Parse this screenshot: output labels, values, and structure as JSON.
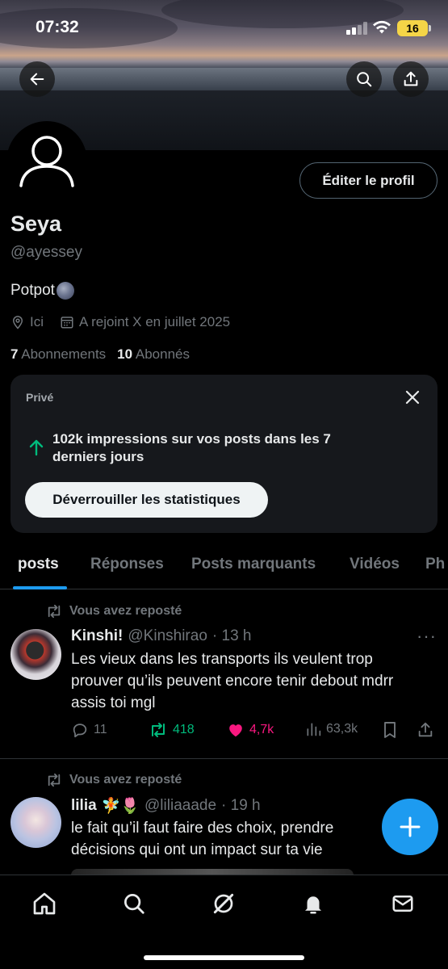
{
  "status_bar": {
    "time": "07:32",
    "battery": "16"
  },
  "profile": {
    "name": "Seya",
    "handle": "@ayessey",
    "bio": "Potpot",
    "location": "Ici",
    "joined": "A rejoint X en juillet 2025",
    "following_count": "7",
    "following_label": "Abonnements",
    "followers_count": "10",
    "followers_label": "Abonnés",
    "edit_label": "Éditer le profil"
  },
  "private_card": {
    "label": "Privé",
    "text": "102k impressions sur vos posts dans les 7 derniers jours",
    "button": "Déverrouiller les statistiques"
  },
  "tabs": [
    "posts",
    "Réponses",
    "Posts marquants",
    "Vidéos",
    "Ph"
  ],
  "active_tab": "posts",
  "posts": [
    {
      "repost_label": "Vous avez reposté",
      "author": "Kinshi!",
      "handle": "@Kinshirao",
      "time": "· 13 h",
      "text_lines": [
        "Les vieux dans les transports ils veulent trop",
        "prouver qu’ils peuvent encore tenir debout mdrr",
        "assis toi mgl"
      ],
      "replies": "11",
      "reposts": "418",
      "likes": "4,7k",
      "views": "63,3k"
    },
    {
      "repost_label": "Vous avez reposté",
      "author": "lilia",
      "author_emojis": "🧚🌷",
      "handle": "@liliaaade",
      "time": "· 19 h",
      "text_lines": [
        "le fait qu’il faut faire des choix, prendre",
        "décisions qui ont un impact sur ta vie"
      ]
    }
  ],
  "colors": {
    "accent": "#1d9bf0",
    "repost_green": "#00ba7c",
    "like_pink": "#f91880",
    "muted": "#71767b"
  },
  "icons": {
    "nav": [
      "home-icon",
      "search-icon",
      "grok-icon",
      "notifications-icon",
      "messages-icon"
    ]
  }
}
